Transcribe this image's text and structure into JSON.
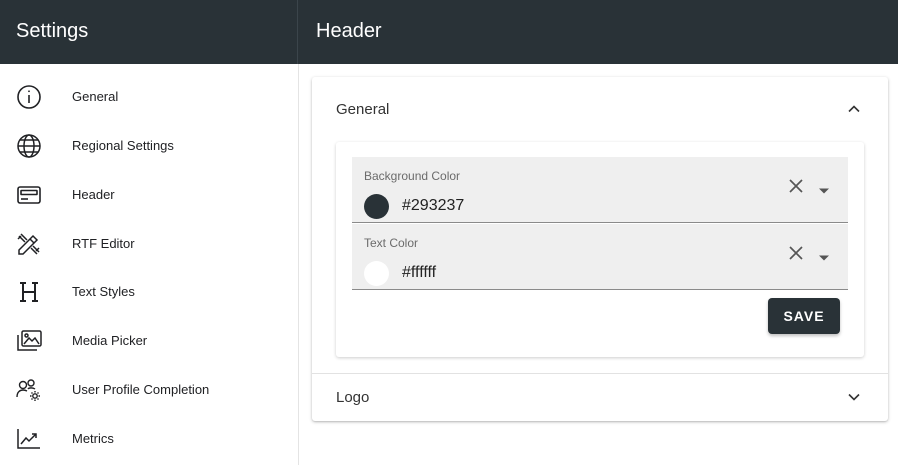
{
  "header": {
    "app_title": "Settings",
    "page_title": "Header"
  },
  "colors": {
    "topbar": "#293237",
    "accent": "#293237"
  },
  "sidebar": {
    "items": [
      {
        "label": "General",
        "icon": "info-icon"
      },
      {
        "label": "Regional Settings",
        "icon": "globe-icon"
      },
      {
        "label": "Header",
        "icon": "header-layout-icon"
      },
      {
        "label": "RTF Editor",
        "icon": "pencil-ruler-icon"
      },
      {
        "label": "Text Styles",
        "icon": "heading-icon"
      },
      {
        "label": "Media Picker",
        "icon": "image-gallery-icon"
      },
      {
        "label": "User Profile Completion",
        "icon": "users-gear-icon"
      },
      {
        "label": "Metrics",
        "icon": "trending-chart-icon"
      }
    ]
  },
  "main": {
    "sections": [
      {
        "title": "General",
        "expanded": true
      },
      {
        "title": "Logo",
        "expanded": false
      }
    ],
    "fields": [
      {
        "label": "Background Color",
        "value": "#293237",
        "swatch": "#293237"
      },
      {
        "label": "Text Color",
        "value": "#ffffff",
        "swatch": "#ffffff"
      }
    ],
    "save_label": "SAVE"
  }
}
